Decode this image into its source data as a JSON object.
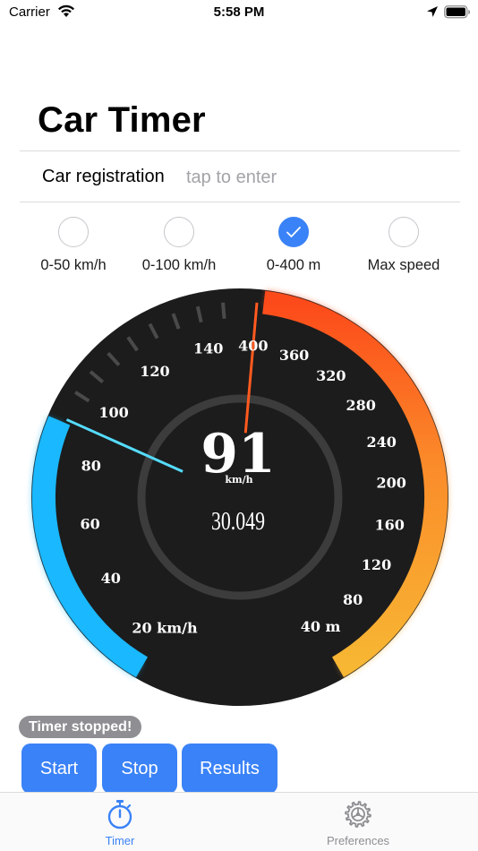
{
  "status_bar": {
    "carrier": "Carrier",
    "time": "5:58 PM"
  },
  "header": {
    "title": "Car Timer"
  },
  "registration": {
    "label": "Car registration",
    "placeholder": "tap to enter"
  },
  "modes": [
    {
      "label": "0-50 km/h",
      "selected": false
    },
    {
      "label": "0-100 km/h",
      "selected": false
    },
    {
      "label": "0-400 m",
      "selected": true
    },
    {
      "label": "Max speed",
      "selected": false
    }
  ],
  "gauge": {
    "speed": "91",
    "speed_unit": "km/h",
    "elapsed": "30.049",
    "speed_ticks": [
      "20 km/h",
      "40",
      "60",
      "80",
      "100",
      "120",
      "140"
    ],
    "distance_ticks": [
      "40 m",
      "80",
      "120",
      "160",
      "200",
      "240",
      "280",
      "320",
      "360",
      "400"
    ],
    "speed_needle_value": 91,
    "distance_needle_value": 400,
    "colors": {
      "speed_arc": "#1ab8ff",
      "distance_arc_start": "#f7b733",
      "distance_arc_end": "#fc4a1a",
      "dial": "#1c1c1c"
    }
  },
  "timer_status": "Timer stopped!",
  "buttons": {
    "start": "Start",
    "stop": "Stop",
    "results": "Results"
  },
  "tabs": [
    {
      "label": "Timer",
      "icon": "stopwatch-icon",
      "active": true
    },
    {
      "label": "Preferences",
      "icon": "gear-icon",
      "active": false
    }
  ],
  "colors": {
    "accent": "#3a82f7",
    "inactive": "#8e8e93",
    "pill": "#8e8e93"
  }
}
